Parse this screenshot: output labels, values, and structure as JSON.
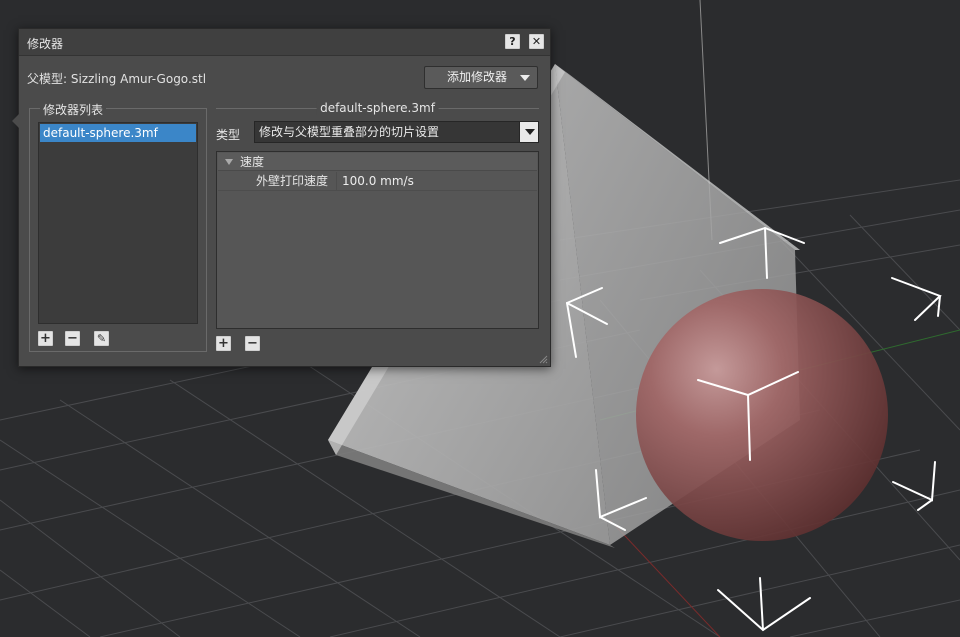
{
  "dialog": {
    "title": "修改器",
    "help_label": "?",
    "close_label": "✕",
    "parent_model_label": "父模型: Sizzling Amur-Gogo.stl",
    "add_modifier_label": "添加修改器"
  },
  "modifier_list": {
    "legend": "修改器列表",
    "items": [
      "default-sphere.3mf"
    ],
    "selected_index": 0,
    "add_label": "+",
    "remove_label": "−",
    "edit_label": "✎"
  },
  "modifier_settings": {
    "file_name": "default-sphere.3mf",
    "type_label": "类型",
    "type_value": "修改与父模型重叠部分的切片设置",
    "category": "速度",
    "property_name": "外壁打印速度",
    "property_value": "100.0 mm/s",
    "add_label": "+",
    "remove_label": "−"
  },
  "colors": {
    "selection": "#3b86c8",
    "dialog_bg": "#4b4b4b",
    "viewport_bg": "#2b2c2e",
    "sphere": "#8a4e4e"
  }
}
